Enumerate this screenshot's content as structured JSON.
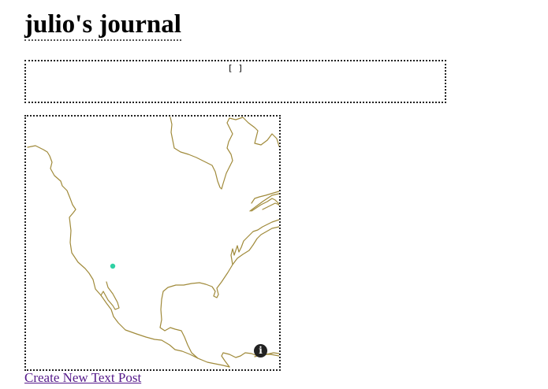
{
  "header": {
    "title": "julio's journal"
  },
  "posts_panel": {
    "content": "[ ]"
  },
  "map": {
    "coastline_color": "#a08a3a",
    "marker_color": "#2fd1a4",
    "info_icon": "info-icon",
    "info_label": "i"
  },
  "footer": {
    "create_link_label": "Create New Text Post"
  }
}
